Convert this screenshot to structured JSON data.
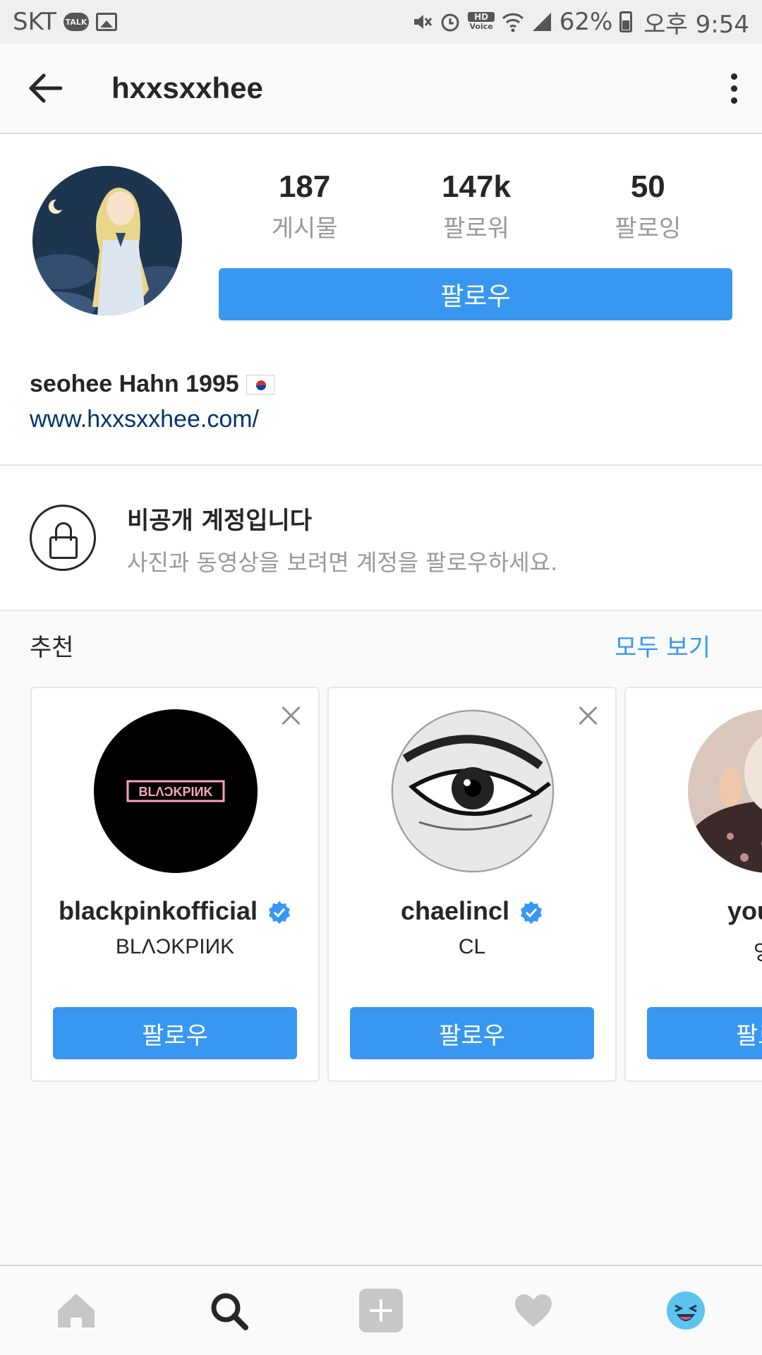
{
  "status_bar": {
    "carrier": "SKT",
    "talk_label": "TALK",
    "hd_label": "HD",
    "hd_sub": "Voice",
    "battery": "62%",
    "time": "오후 9:54"
  },
  "header": {
    "username": "hxxsxxhee"
  },
  "profile": {
    "stats": [
      {
        "value": "187",
        "label": "게시물"
      },
      {
        "value": "147k",
        "label": "팔로워"
      },
      {
        "value": "50",
        "label": "팔로잉"
      }
    ],
    "follow_label": "팔로우",
    "full_name": "seohee Hahn 1995",
    "website": "www.hxxsxxhee.com/"
  },
  "private_notice": {
    "title": "비공개 계정입니다",
    "subtitle": "사진과 동영상을 보려면 계정을 팔로우하세요."
  },
  "suggestions": {
    "title": "추천",
    "see_all": "모두 보기",
    "cards": [
      {
        "username": "blackpinkofficial",
        "name": "BLΛƆKPIИK",
        "follow_label": "팔로우",
        "logo_text": "BLΛƆKPIИK"
      },
      {
        "username": "chaelincl",
        "name": "CL",
        "follow_label": "팔로우"
      },
      {
        "username": "you_r_",
        "name": "잉? ",
        "follow_label": "팔로우"
      }
    ]
  },
  "colors": {
    "accent": "#3897f0",
    "link": "#003569",
    "verified": "#3897f0"
  }
}
